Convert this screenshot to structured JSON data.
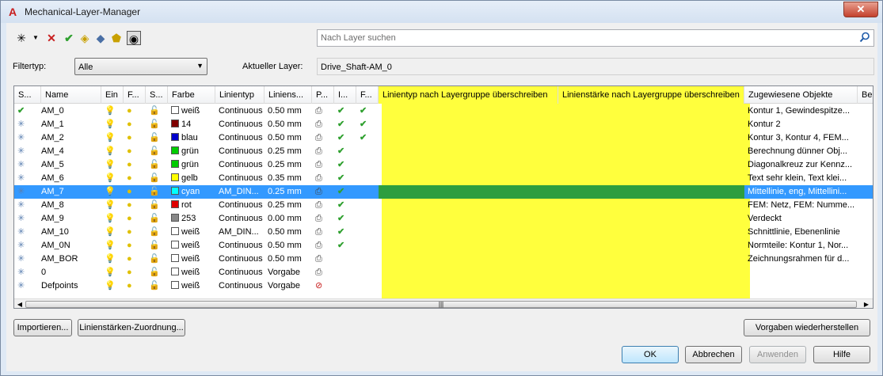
{
  "window": {
    "title": "Mechanical-Layer-Manager",
    "close_label": "✕"
  },
  "toolbar": {
    "search_placeholder": "Nach Layer suchen",
    "filter_label": "Filtertyp:",
    "filter_value": "Alle",
    "current_layer_label": "Aktueller Layer:",
    "current_layer_value": "Drive_Shaft-AM_0"
  },
  "columns": [
    "S...",
    "Name",
    "Ein",
    "F...",
    "S...",
    "Farbe",
    "Linientyp",
    "Liniens...",
    "P...",
    "I...",
    "F...",
    "Linientyp nach Layergruppe überschreiben",
    "Linienstärke nach Layergruppe überschreiben",
    "Zugewiesene Objekte",
    "Be"
  ],
  "layers": [
    {
      "name": "AM_0",
      "color": "weiß",
      "swatch": "#ffffff",
      "linetype": "Continuous",
      "lineweight": "0.50 mm",
      "i": true,
      "f": true,
      "objects": "Kontur 1, Gewindespitze...",
      "current": true
    },
    {
      "name": "AM_1",
      "color": "14",
      "swatch": "#800000",
      "linetype": "Continuous",
      "lineweight": "0.50 mm",
      "i": true,
      "f": true,
      "objects": "Kontur 2"
    },
    {
      "name": "AM_2",
      "color": "blau",
      "swatch": "#0000cc",
      "linetype": "Continuous",
      "lineweight": "0.50 mm",
      "i": true,
      "f": true,
      "objects": "Kontur 3, Kontur 4, FEM..."
    },
    {
      "name": "AM_4",
      "color": "grün",
      "swatch": "#00cc00",
      "linetype": "Continuous",
      "lineweight": "0.25 mm",
      "i": true,
      "f": false,
      "objects": "Berechnung dünner Obj..."
    },
    {
      "name": "AM_5",
      "color": "grün",
      "swatch": "#00cc00",
      "linetype": "Continuous",
      "lineweight": "0.25 mm",
      "i": true,
      "f": false,
      "objects": "Diagonalkreuz zur Kennz..."
    },
    {
      "name": "AM_6",
      "color": "gelb",
      "swatch": "#ffff00",
      "linetype": "Continuous",
      "lineweight": "0.35 mm",
      "i": true,
      "f": false,
      "objects": "Text sehr klein, Text klei..."
    },
    {
      "name": "AM_7",
      "color": "cyan",
      "swatch": "#00ffff",
      "linetype": "AM_DIN...",
      "lineweight": "0.25 mm",
      "i": true,
      "f": false,
      "objects": "Mittellinie, eng, Mittellini...",
      "selected": true
    },
    {
      "name": "AM_8",
      "color": "rot",
      "swatch": "#e00000",
      "linetype": "Continuous",
      "lineweight": "0.25 mm",
      "i": true,
      "f": false,
      "objects": "FEM: Netz, FEM: Numme..."
    },
    {
      "name": "AM_9",
      "color": "253",
      "swatch": "#888888",
      "linetype": "Continuous",
      "lineweight": "0.00 mm",
      "i": true,
      "f": false,
      "objects": "Verdeckt"
    },
    {
      "name": "AM_10",
      "color": "weiß",
      "swatch": "#ffffff",
      "linetype": "AM_DIN...",
      "lineweight": "0.50 mm",
      "i": true,
      "f": false,
      "objects": "Schnittlinie, Ebenenlinie"
    },
    {
      "name": "AM_0N",
      "color": "weiß",
      "swatch": "#ffffff",
      "linetype": "Continuous",
      "lineweight": "0.50 mm",
      "i": true,
      "f": false,
      "objects": "Normteile: Kontur 1, Nor..."
    },
    {
      "name": "AM_BOR",
      "color": "weiß",
      "swatch": "#ffffff",
      "linetype": "Continuous",
      "lineweight": "0.50 mm",
      "i": false,
      "f": false,
      "objects": "Zeichnungsrahmen für d..."
    },
    {
      "name": "0",
      "color": "weiß",
      "swatch": "#ffffff",
      "linetype": "Continuous",
      "lineweight": "Vorgabe",
      "i": false,
      "f": false,
      "objects": ""
    },
    {
      "name": "Defpoints",
      "color": "weiß",
      "swatch": "#ffffff",
      "linetype": "Continuous",
      "lineweight": "Vorgabe",
      "i": false,
      "f": false,
      "objects": "",
      "noplot": true
    }
  ],
  "buttons": {
    "import": "Importieren...",
    "lineweight_map": "Linienstärken-Zuordnung...",
    "restore": "Vorgaben wiederherstellen",
    "ok": "OK",
    "cancel": "Abbrechen",
    "apply": "Anwenden",
    "help": "Hilfe"
  },
  "colors": {
    "highlight": "#ffff3d",
    "selection": "#3399ff",
    "check": "#2fa02f"
  }
}
